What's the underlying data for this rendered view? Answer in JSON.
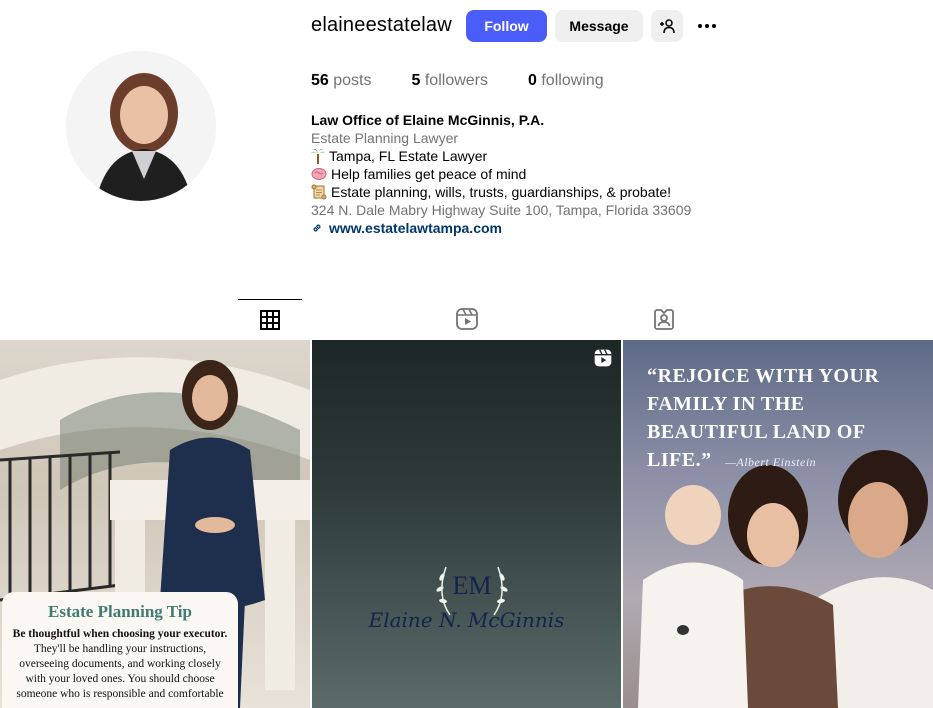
{
  "profile": {
    "username": "elaineestatelaw",
    "follow_label": "Follow",
    "message_label": "Message",
    "stats": {
      "posts_count": "56",
      "posts_label": "posts",
      "followers_count": "5",
      "followers_label": "followers",
      "following_count": "0",
      "following_label": "following"
    },
    "bio": {
      "name": "Law Office of Elaine McGinnis, P.A.",
      "category": "Estate Planning Lawyer",
      "line1": "Tampa, FL Estate Lawyer",
      "line2": "Help families get peace of mind",
      "line3": "Estate planning, wills, trusts, guardianships, & probate!",
      "address": "324 N. Dale Mabry Highway Suite 100, Tampa, Florida 33609",
      "link": "www.estatelawtampa.com"
    }
  },
  "posts": {
    "tip": {
      "title": "Estate Planning Tip",
      "bold": "Be thoughtful when choosing your executor.",
      "body": "They'll be handling your instructions, overseeing documents, and working closely with your loved ones. You should choose someone who is responsible and comfortable"
    },
    "logo": {
      "monogram": "EM",
      "name": "Elaine N. McGinnis"
    },
    "quote": {
      "text": "“REJOICE WITH YOUR FAMILY IN THE BEAUTIFUL LAND OF LIFE.”",
      "author": "—Albert Einstein"
    }
  },
  "colors": {
    "follow_button": "#4a5df9",
    "link": "#00376b",
    "muted": "#737373",
    "tip_title": "#3f7a73"
  },
  "icons": {
    "tab_posts": "grid-icon",
    "tab_reels": "reels-icon",
    "tab_tagged": "tagged-icon",
    "suggest": "add-person-icon",
    "more": "more-icon"
  }
}
